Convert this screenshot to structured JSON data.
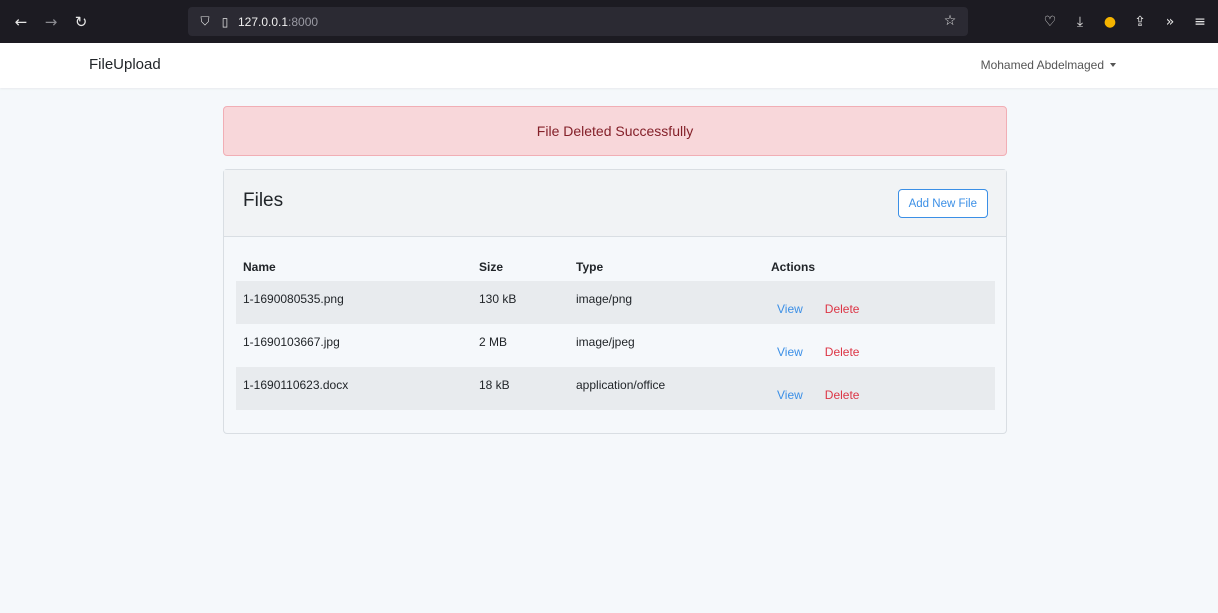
{
  "browser": {
    "url_host": "127.0.0.1",
    "url_port": ":8000"
  },
  "navbar": {
    "brand": "FileUpload",
    "user_name": "Mohamed Abdelmaged"
  },
  "alert": {
    "message": "File Deleted Successfully"
  },
  "card": {
    "title": "Files",
    "add_button": "Add New File"
  },
  "table": {
    "headers": [
      "Name",
      "Size",
      "Type",
      "Actions"
    ],
    "rows": [
      {
        "name": "1-1690080535.png",
        "size": "130 kB",
        "type": "image/png",
        "view": "View",
        "delete": "Delete"
      },
      {
        "name": "1-1690103667.jpg",
        "size": "2 MB",
        "type": "image/jpeg",
        "view": "View",
        "delete": "Delete"
      },
      {
        "name": "1-1690110623.docx",
        "size": "18 kB",
        "type": "application/office",
        "view": "View",
        "delete": "Delete"
      }
    ]
  }
}
